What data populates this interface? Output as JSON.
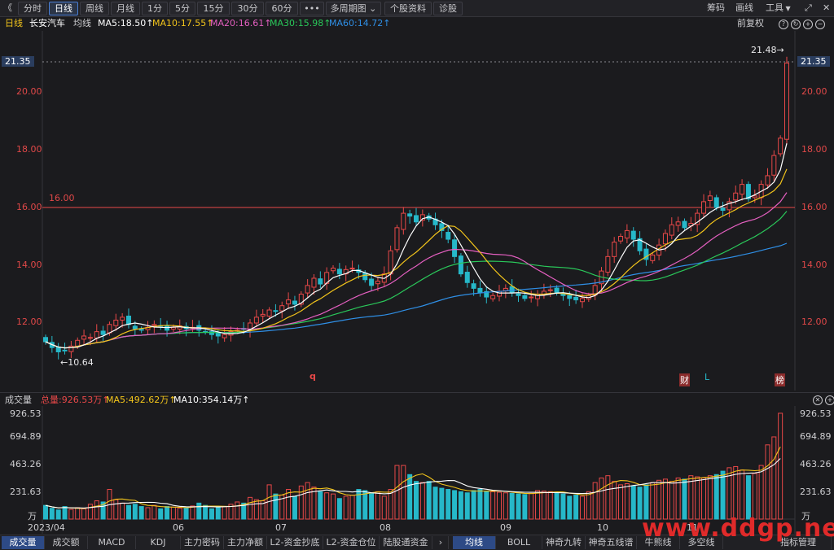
{
  "toolbar": {
    "back": "《",
    "periods": [
      "分时",
      "日线",
      "周线",
      "月线",
      "1分",
      "5分",
      "15分",
      "30分",
      "60分"
    ],
    "more": "•••",
    "multi": "多周期图",
    "profile": "个股资料",
    "diagnose": "诊股",
    "right": [
      "筹码",
      "画线",
      "工具"
    ]
  },
  "mabar": {
    "period": "日线",
    "stock": "长安汽车",
    "avg": "均线",
    "ma5": "MA5:18.50↑",
    "ma10": "MA10:17.55↑",
    "ma20": "MA20:16.61↑",
    "ma30": "MA30:15.98↑",
    "ma60": "MA60:14.72↑",
    "adjust": "前复权"
  },
  "colors": {
    "up": "#e84848",
    "down": "#26b8c9",
    "ma5": "#ffffff",
    "ma10": "#f2c41b",
    "ma20": "#e45fc0",
    "ma30": "#2ac85a",
    "ma60": "#2f8fe6"
  },
  "price_axis": {
    "labels": [
      "21.35",
      "20.00",
      "18.00",
      "16.00",
      "14.00",
      "12.00"
    ]
  },
  "annotations": {
    "hline": "16.00",
    "high": "21.48",
    "low": "10.64",
    "markers": [
      "q",
      "财",
      "L",
      "榜"
    ]
  },
  "volbar": {
    "title": "成交量",
    "total": "总量:926.53万↑",
    "ma5": "MA5:492.62万↑",
    "ma10": "MA10:354.14万↑"
  },
  "vol_axis": {
    "labels": [
      "926.53",
      "694.89",
      "463.26",
      "231.63",
      "万"
    ]
  },
  "time_axis": [
    "2023/04",
    "06",
    "07",
    "08",
    "09",
    "10",
    "11"
  ],
  "tabs_left": [
    "成交量",
    "成交额",
    "MACD",
    "KDJ",
    "主力密码",
    "主力净额",
    "L2-资金抄底",
    "L2-资金仓位",
    "陆股通资金"
  ],
  "tabs_right": [
    "均线",
    "BOLL",
    "神奇九转",
    "神奇五线谱",
    "牛熊线",
    "多空线",
    "指标管理"
  ],
  "watermark": "www.ddgp.net",
  "chart_data": {
    "type": "candlestick",
    "ylim": [
      10.5,
      22.0
    ],
    "hline": 16.0,
    "closes": [
      11.35,
      11.15,
      11.0,
      11.05,
      11.2,
      11.4,
      11.55,
      11.5,
      11.7,
      11.6,
      11.95,
      12.1,
      12.2,
      11.95,
      11.8,
      11.75,
      11.85,
      11.95,
      11.9,
      11.75,
      11.85,
      11.9,
      11.8,
      11.85,
      11.75,
      11.7,
      11.6,
      11.55,
      11.6,
      11.7,
      11.75,
      11.8,
      12.0,
      12.2,
      12.3,
      12.45,
      12.4,
      12.6,
      12.8,
      12.65,
      13.0,
      13.3,
      13.55,
      13.35,
      13.75,
      13.9,
      13.7,
      13.85,
      13.9,
      13.75,
      13.5,
      13.3,
      13.45,
      13.7,
      14.5,
      15.3,
      15.8,
      15.7,
      15.5,
      15.75,
      15.6,
      15.4,
      15.2,
      14.9,
      14.3,
      13.7,
      13.4,
      13.2,
      13.05,
      12.9,
      12.95,
      13.1,
      13.2,
      13.05,
      12.95,
      12.85,
      12.9,
      13.0,
      13.1,
      13.15,
      13.05,
      12.95,
      12.85,
      12.8,
      12.85,
      12.95,
      13.3,
      13.8,
      14.3,
      14.8,
      15.0,
      15.2,
      14.9,
      14.5,
      14.2,
      14.35,
      14.7,
      15.1,
      15.4,
      15.5,
      15.3,
      15.45,
      15.8,
      16.2,
      16.4,
      16.0,
      15.9,
      16.2,
      16.5,
      16.8,
      16.3,
      16.4,
      16.8,
      17.1,
      17.8,
      18.4,
      21.0
    ],
    "volumes": [
      120,
      95,
      80,
      110,
      85,
      100,
      90,
      130,
      160,
      150,
      260,
      170,
      140,
      120,
      130,
      110,
      100,
      120,
      90,
      110,
      105,
      95,
      100,
      115,
      140,
      120,
      90,
      100,
      110,
      130,
      150,
      140,
      190,
      170,
      160,
      300,
      220,
      210,
      260,
      200,
      290,
      320,
      280,
      240,
      230,
      220,
      180,
      200,
      210,
      260,
      250,
      230,
      240,
      200,
      260,
      470,
      470,
      390,
      330,
      320,
      330,
      280,
      270,
      260,
      250,
      240,
      230,
      250,
      260,
      245,
      240,
      235,
      230,
      225,
      220,
      215,
      225,
      250,
      245,
      240,
      230,
      220,
      200,
      210,
      200,
      240,
      320,
      360,
      380,
      330,
      300,
      310,
      290,
      280,
      300,
      320,
      340,
      350,
      330,
      360,
      350,
      380,
      370,
      360,
      380,
      390,
      420,
      450,
      460,
      430,
      380,
      400,
      470,
      650,
      720,
      927
    ],
    "ma5_last": 18.5,
    "ma10_last": 17.55,
    "ma20_last": 16.61,
    "ma30_last": 15.98,
    "ma60_last": 14.72,
    "vol_max": 926.53
  }
}
